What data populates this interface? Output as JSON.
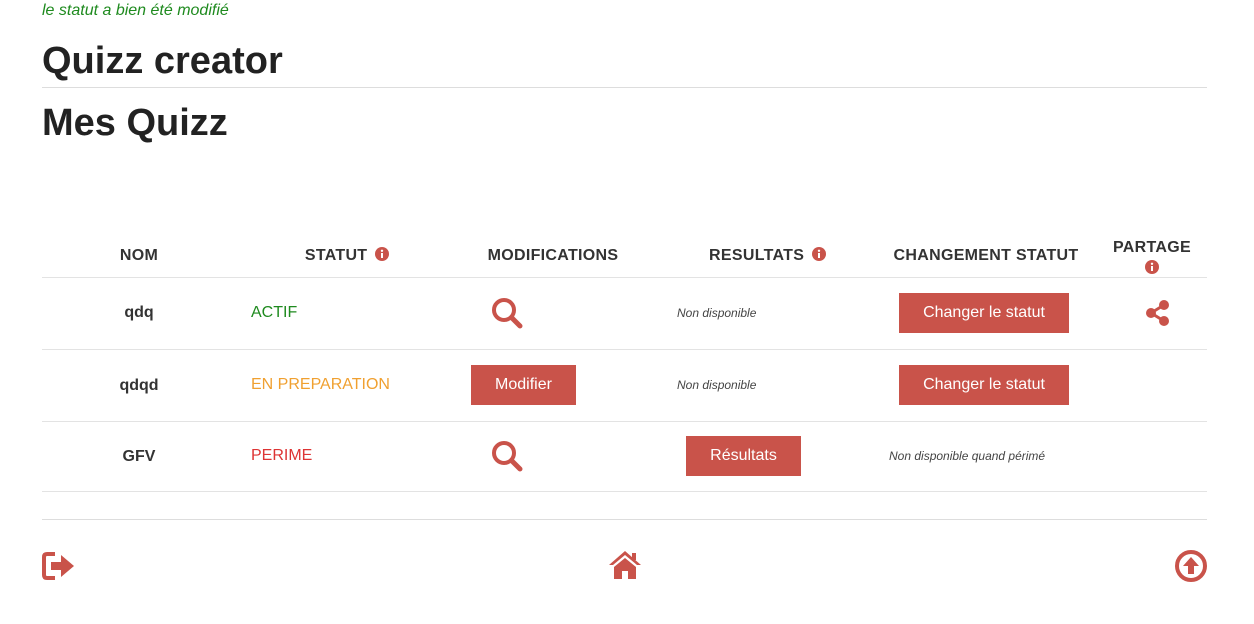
{
  "flash_message": "le statut a bien été modifié",
  "page_title": "Quizz creator",
  "section_title": "Mes Quizz",
  "table": {
    "headers": {
      "nom": "NOM",
      "statut": "STATUT",
      "modifications": "MODIFICATIONS",
      "resultats": "RESULTATS",
      "changement_statut": "CHANGEMENT STATUT",
      "partage": "PARTAGE"
    },
    "rows": [
      {
        "nom": "qdq",
        "statut": "ACTIF",
        "resultats": "Non disponible",
        "changement": "Changer le statut"
      },
      {
        "nom": "qdqd",
        "statut": "EN PREPARATION",
        "modification": "Modifier",
        "resultats": "Non disponible",
        "changement": "Changer le statut"
      },
      {
        "nom": "GFV",
        "statut": "PERIME",
        "resultats": "Résultats",
        "changement": "Non disponible quand périmé"
      }
    ]
  },
  "colors": {
    "accent": "#c9534a",
    "actif": "#1e8a1e",
    "preparation": "#f0a030",
    "perime": "#dd3333",
    "flash": "#1e8a1e"
  },
  "icons": {
    "info": "info-circle-icon",
    "view": "search-icon",
    "share": "share-icon",
    "logout": "sign-out-icon",
    "home": "home-icon",
    "top": "arrow-circle-up-icon"
  }
}
